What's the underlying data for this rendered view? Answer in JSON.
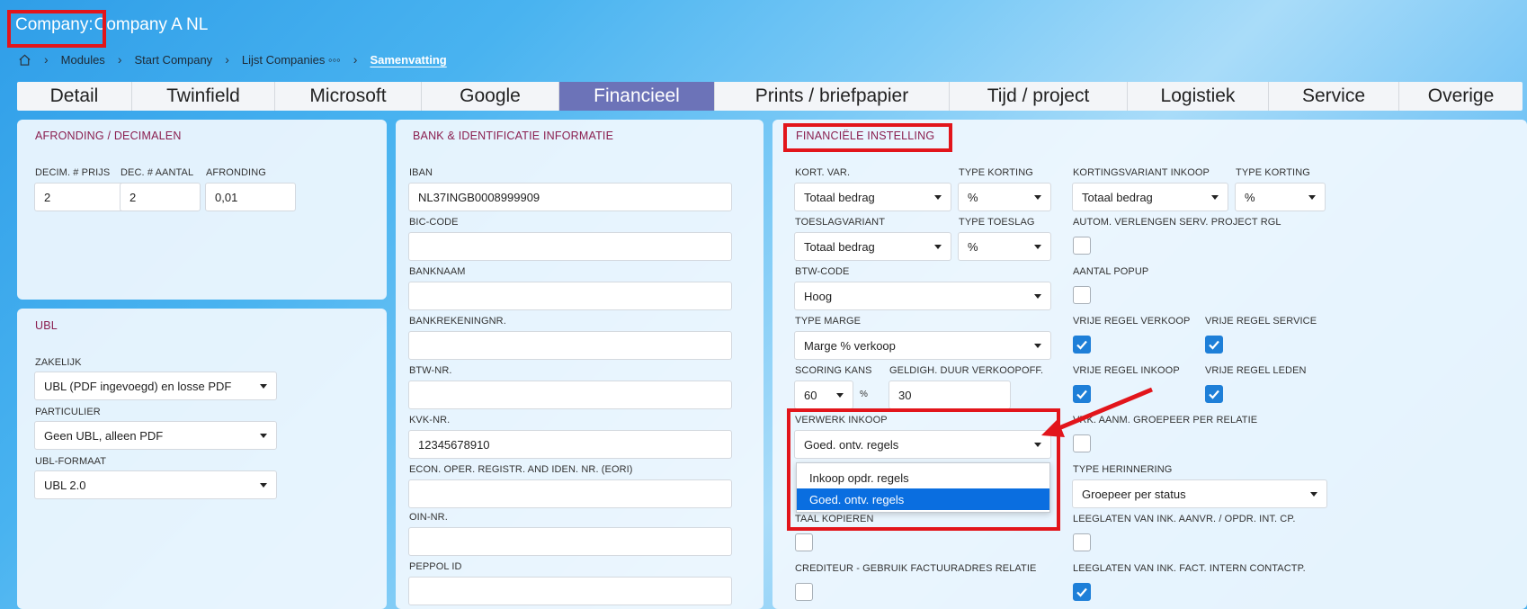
{
  "header": {
    "company_label": "Company:",
    "company_name": "Company A NL"
  },
  "breadcrumb": {
    "items": [
      "Modules",
      "Start Company",
      "Lijst Companies ◦◦◦"
    ],
    "current": "Samenvatting"
  },
  "tabs": [
    "Detail",
    "Twinfield",
    "Microsoft",
    "Google",
    "Financieel",
    "Prints / briefpapier",
    "Tijd / project",
    "Logistiek",
    "Service",
    "Overige"
  ],
  "active_tab": "Financieel",
  "afronding": {
    "title": "AFRONDING / DECIMALEN",
    "decim_prijs_label": "DECIM. # PRIJS",
    "decim_prijs": "2",
    "dec_aantal_label": "DEC. # AANTAL",
    "dec_aantal": "2",
    "afronding_label": "AFRONDING",
    "afronding": "0,01"
  },
  "ubl": {
    "title": "UBL",
    "zakelijk_label": "ZAKELIJK",
    "zakelijk": "UBL (PDF ingevoegd) en losse PDF",
    "particulier_label": "PARTICULIER",
    "particulier": "Geen UBL, alleen PDF",
    "formaat_label": "UBL-FORMAAT",
    "formaat": "UBL 2.0"
  },
  "bank": {
    "title": "BANK & IDENTIFICATIE INFORMATIE",
    "iban_label": "IBAN",
    "iban": "NL37INGB0008999909",
    "bic_label": "BIC-CODE",
    "bic": "",
    "banknaam_label": "BANKNAAM",
    "banknaam": "",
    "rekening_label": "BANKREKENINGNR.",
    "rekening": "",
    "btw_label": "BTW-NR.",
    "btw": "",
    "kvk_label": "KVK-NR.",
    "kvk": "12345678910",
    "eori_label": "ECON. OPER. REGISTR. AND IDEN. NR. (EORI)",
    "eori": "",
    "oin_label": "OIN-NR.",
    "oin": "",
    "peppol_label": "PEPPOL ID",
    "peppol": ""
  },
  "financieel": {
    "title": "FINANCIËLE INSTELLING",
    "kort_var_label": "KORT. VAR.",
    "kort_var": "Totaal bedrag",
    "type_korting_label": "TYPE KORTING",
    "type_korting": "%",
    "kortingsvariant_inkoop_label": "KORTINGSVARIANT INKOOP",
    "kortingsvariant_inkoop": "Totaal bedrag",
    "type_korting2_label": "TYPE KORTING",
    "type_korting2": "%",
    "toeslagvariant_label": "TOESLAGVARIANT",
    "toeslagvariant": "Totaal bedrag",
    "type_toeslag_label": "TYPE TOESLAG",
    "type_toeslag": "%",
    "autom_label": "AUTOM. VERLENGEN SERV. PROJECT RGL",
    "btw_code_label": "BTW-CODE",
    "btw_code": "Hoog",
    "aantal_popup_label": "AANTAL POPUP",
    "type_marge_label": "TYPE MARGE",
    "type_marge": "Marge % verkoop",
    "vrije_verkoop_label": "VRIJE REGEL VERKOOP",
    "vrije_service_label": "VRIJE REGEL SERVICE",
    "scoring_label": "SCORING KANS",
    "scoring": "60",
    "scoring_unit": "%",
    "geldigh_label": "GELDIGH. DUUR VERKOOPOFF.",
    "geldigh": "30",
    "vrije_inkoop_label": "VRIJE REGEL INKOOP",
    "vrije_leden_label": "VRIJE REGEL LEDEN",
    "verwerk_label": "VERWERK INKOOP",
    "verwerk": "Goed. ontv. regels",
    "vrk_aanm_label": "VRK. AANM. GROEPEER PER RELATIE",
    "type_herinnering_label": "TYPE HERINNERING",
    "type_herinnering": "Groepeer per status",
    "taal_label": "TAAL KOPIEREN",
    "leeglaten_aanvr_label": "LEEGLATEN VAN INK. AANVR. / OPDR. INT. CP.",
    "crediteur_label": "CREDITEUR - GEBRUIK FACTUURADRES RELATIE",
    "leeglaten_fact_label": "LEEGLATEN VAN INK. FACT. INTERN CONTACTP."
  },
  "dropdown": {
    "options": [
      "Inkoop opdr. regels",
      "Goed. ontv. regels"
    ],
    "selected": "Goed. ontv. regels"
  },
  "colors": {
    "accent": "#6c73b8",
    "panel_title": "#8a1e4f",
    "highlight": "#e2151b",
    "checkbox": "#1e7fd8",
    "selected_option": "#0a6ee0"
  }
}
